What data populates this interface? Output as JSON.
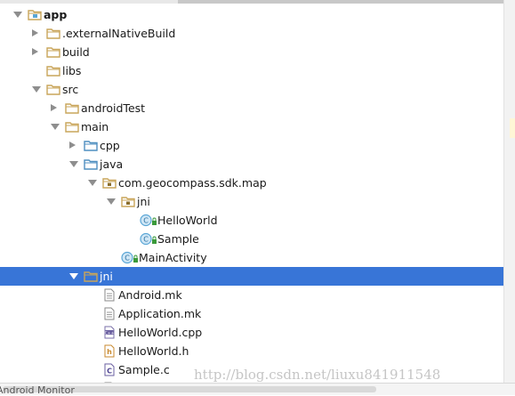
{
  "tree": {
    "rows": [
      {
        "label": "app",
        "depth": 0,
        "arrow": "down",
        "icon": "module-folder-icon",
        "bold": true,
        "selected": false
      },
      {
        "label": ".externalNativeBuild",
        "depth": 1,
        "arrow": "right",
        "icon": "folder-icon",
        "bold": false,
        "selected": false
      },
      {
        "label": "build",
        "depth": 1,
        "arrow": "right",
        "icon": "folder-icon",
        "bold": false,
        "selected": false
      },
      {
        "label": "libs",
        "depth": 1,
        "arrow": "none",
        "icon": "folder-icon",
        "bold": false,
        "selected": false
      },
      {
        "label": "src",
        "depth": 1,
        "arrow": "down",
        "icon": "folder-icon",
        "bold": false,
        "selected": false
      },
      {
        "label": "androidTest",
        "depth": 2,
        "arrow": "right",
        "icon": "folder-icon",
        "bold": false,
        "selected": false
      },
      {
        "label": "main",
        "depth": 2,
        "arrow": "down",
        "icon": "folder-icon",
        "bold": false,
        "selected": false
      },
      {
        "label": "cpp",
        "depth": 3,
        "arrow": "right",
        "icon": "source-folder-icon",
        "bold": false,
        "selected": false
      },
      {
        "label": "java",
        "depth": 3,
        "arrow": "down",
        "icon": "source-folder-icon",
        "bold": false,
        "selected": false
      },
      {
        "label": "com.geocompass.sdk.map",
        "depth": 4,
        "arrow": "down",
        "icon": "package-icon",
        "bold": false,
        "selected": false
      },
      {
        "label": "jni",
        "depth": 5,
        "arrow": "down",
        "icon": "package-icon",
        "bold": false,
        "selected": false
      },
      {
        "label": "HelloWorld",
        "depth": 6,
        "arrow": "none",
        "icon": "java-class-icon",
        "bold": false,
        "selected": false
      },
      {
        "label": "Sample",
        "depth": 6,
        "arrow": "none",
        "icon": "java-class-icon",
        "bold": false,
        "selected": false
      },
      {
        "label": "MainActivity",
        "depth": 5,
        "arrow": "none",
        "icon": "java-class-icon",
        "bold": false,
        "selected": false
      },
      {
        "label": "jni",
        "depth": 3,
        "arrow": "down",
        "icon": "folder-icon",
        "bold": false,
        "selected": true
      },
      {
        "label": "Android.mk",
        "depth": 4,
        "arrow": "none",
        "icon": "text-file-icon",
        "bold": false,
        "selected": false
      },
      {
        "label": "Application.mk",
        "depth": 4,
        "arrow": "none",
        "icon": "text-file-icon",
        "bold": false,
        "selected": false
      },
      {
        "label": "HelloWorld.cpp",
        "depth": 4,
        "arrow": "none",
        "icon": "cpp-file-icon",
        "bold": false,
        "selected": false
      },
      {
        "label": "HelloWorld.h",
        "depth": 4,
        "arrow": "none",
        "icon": "header-file-icon",
        "bold": false,
        "selected": false
      },
      {
        "label": "Sample.c",
        "depth": 4,
        "arrow": "none",
        "icon": "c-file-icon",
        "bold": false,
        "selected": false
      },
      {
        "label": "",
        "depth": 4,
        "arrow": "none",
        "icon": "text-file-icon",
        "bold": false,
        "selected": false
      }
    ]
  },
  "bottom_tool_window": "Android Monitor",
  "watermark": "http://blog.csdn.net/liuxu841911548",
  "colors": {
    "selection": "#3875d7",
    "folder": "#c9a55a",
    "source_folder": "#4f8fc0",
    "class_circle": "#5aa6d6",
    "lock_green": "#3b9a3b"
  }
}
